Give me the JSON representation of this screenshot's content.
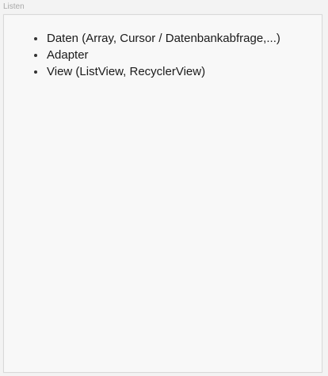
{
  "frame": {
    "label": "Listen"
  },
  "slide": {
    "bullets": [
      "Daten (Array, Cursor / Datenbankabfrage,...)",
      "Adapter",
      "View (ListView, RecyclerView)"
    ]
  }
}
